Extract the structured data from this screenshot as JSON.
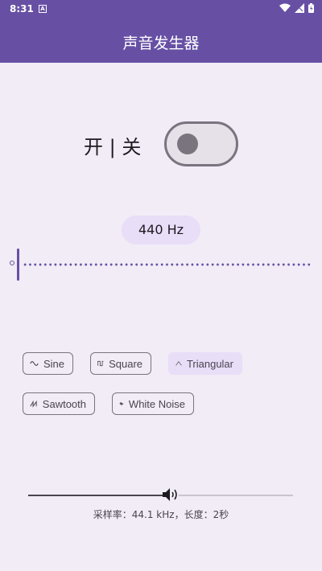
{
  "status": {
    "time": "8:31",
    "notification_glyph": "A"
  },
  "app": {
    "title": "声音发生器"
  },
  "power": {
    "label": "开 | 关",
    "switch_on": false
  },
  "frequency": {
    "display": "440 Hz"
  },
  "waveforms": [
    {
      "label": "Sine",
      "icon": "sine-wave-icon",
      "selected": false
    },
    {
      "label": "Square",
      "icon": "square-wave-icon",
      "selected": false
    },
    {
      "label": "Triangular",
      "icon": "triangle-wave-icon",
      "selected": true
    },
    {
      "label": "Sawtooth",
      "icon": "sawtooth-wave-icon",
      "selected": false
    },
    {
      "label": "White Noise",
      "icon": "noise-wave-icon",
      "selected": false
    }
  ],
  "volume": {
    "icon": "speaker-icon"
  },
  "info": {
    "text": "采样率：44.1 kHz，长度：2秒"
  },
  "colors": {
    "primary": "#6750a4",
    "background": "#f1ecf6",
    "chip_selected": "#e8def8",
    "outline": "#79747e"
  }
}
